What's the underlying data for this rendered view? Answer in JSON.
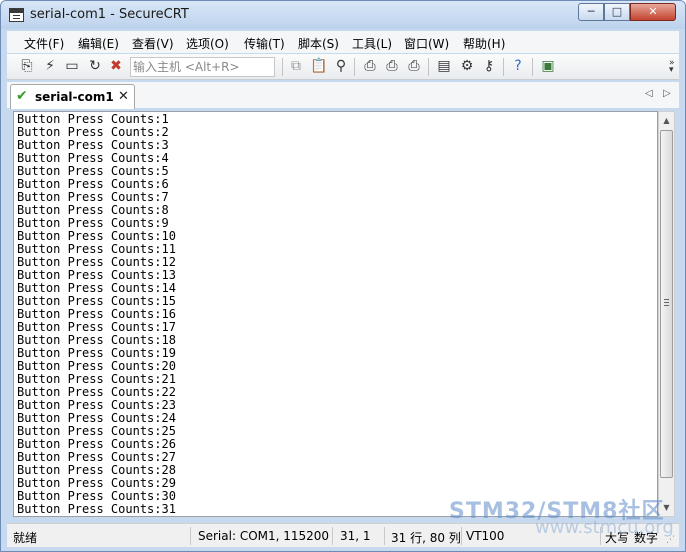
{
  "window": {
    "title": "serial-com1 - SecureCRT"
  },
  "titlebar_controls": {
    "minimize": "─",
    "maximize": "□",
    "close": "✕"
  },
  "menu": [
    {
      "label": "文件(F)"
    },
    {
      "label": "编辑(E)"
    },
    {
      "label": "查看(V)"
    },
    {
      "label": "选项(O)"
    },
    {
      "label": "传输(T)"
    },
    {
      "label": "脚本(S)"
    },
    {
      "label": "工具(L)"
    },
    {
      "label": "窗口(W)"
    },
    {
      "label": "帮助(H)"
    }
  ],
  "toolbar": {
    "host_input_placeholder": "输入主机 <Alt+R>",
    "icons": [
      "connect-icon",
      "quick-connect-icon",
      "connect-tab-icon",
      "reconnect-icon",
      "disconnect-icon",
      "copy-icon",
      "paste-icon",
      "find-icon",
      "print-screen-icon",
      "print-selection-icon",
      "print-icon",
      "session-options-icon",
      "global-options-icon",
      "keymap-icon",
      "help-icon",
      "sftp-icon"
    ]
  },
  "tabs": [
    {
      "label": "serial-com1",
      "status": "connected"
    }
  ],
  "terminal": {
    "lines": [
      "Button Press Counts:1",
      "Button Press Counts:2",
      "Button Press Counts:3",
      "Button Press Counts:4",
      "Button Press Counts:5",
      "Button Press Counts:6",
      "Button Press Counts:7",
      "Button Press Counts:8",
      "Button Press Counts:9",
      "Button Press Counts:10",
      "Button Press Counts:11",
      "Button Press Counts:12",
      "Button Press Counts:13",
      "Button Press Counts:14",
      "Button Press Counts:15",
      "Button Press Counts:16",
      "Button Press Counts:17",
      "Button Press Counts:18",
      "Button Press Counts:19",
      "Button Press Counts:20",
      "Button Press Counts:21",
      "Button Press Counts:22",
      "Button Press Counts:23",
      "Button Press Counts:24",
      "Button Press Counts:25",
      "Button Press Counts:26",
      "Button Press Counts:27",
      "Button Press Counts:28",
      "Button Press Counts:29",
      "Button Press Counts:30",
      "Button Press Counts:31"
    ]
  },
  "statusbar": {
    "ready": "就绪",
    "connection": "Serial: COM1, 115200",
    "cursor": "31,   1",
    "size": "31 行, 80 列",
    "emulation": "VT100",
    "caps": "大写",
    "num": "数字"
  },
  "watermark": {
    "main": "STM32/STM8社区",
    "sub": "www.stmcu.org"
  },
  "colors": {
    "titlebar": "#bcd2ec",
    "close_button": "#c4432f",
    "tab_check": "#3a9a2a",
    "watermark": "#5e8cc8"
  }
}
